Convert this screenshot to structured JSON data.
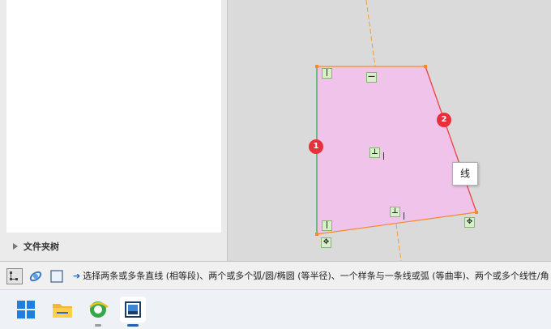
{
  "left_panel": {
    "folder_tree_label": "文件夹树"
  },
  "sketch": {
    "fill_color": "#efc3ea",
    "edge_color": "#f58a2a",
    "left_edge_color": "#3aa84a",
    "badges": [
      "1",
      "2"
    ],
    "tooltip": "线",
    "relation_icons": [
      "vertical-relation-icon",
      "horizontal-relation-icon",
      "perpendicular-relation-icon",
      "perpendicular-relation-icon",
      "vertical-relation-icon",
      "fix-point-icon",
      "fix-point-icon"
    ]
  },
  "command_strip": {
    "prompt": "选择两条或多条直线 (相等段)、两个或多个弧/圆/椭圆 (等半径)、一个样条与一条线或弧 (等曲率)、两个或多个线性/角"
  },
  "taskbar": {
    "apps": [
      "windows-start-icon",
      "file-explorer-icon",
      "browser-icon",
      "cad-app-icon"
    ],
    "accent_color": "#2a5db0"
  }
}
